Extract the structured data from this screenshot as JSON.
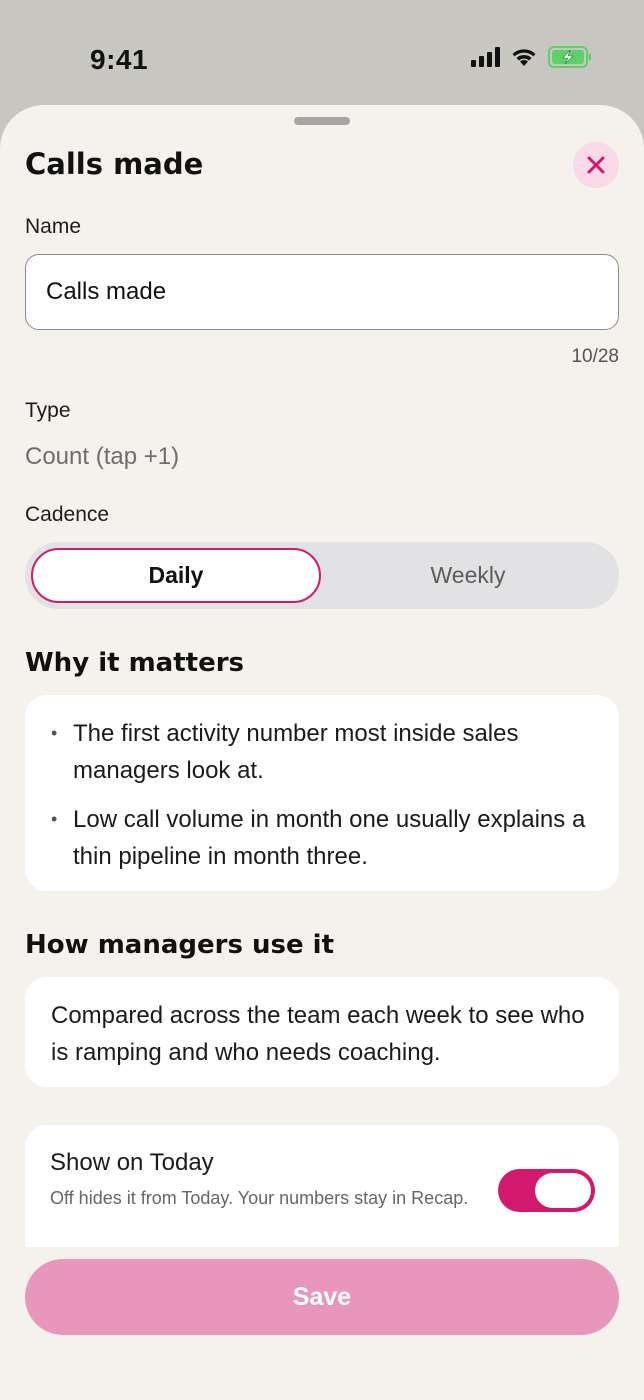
{
  "status_bar": {
    "time": "9:41",
    "icons": [
      "signal-icon",
      "wifi-icon",
      "battery-charging-icon"
    ]
  },
  "sheet": {
    "title": "Calls made",
    "close_icon": "close-icon",
    "name_label": "Name",
    "name_value": "Calls made",
    "name_counter": "10/28",
    "type_label": "Type",
    "type_value": "Count (tap +1)",
    "cadence_label": "Cadence",
    "cadence_options": [
      "Daily",
      "Weekly"
    ],
    "cadence_selected": "Daily",
    "why_title": "Why it matters",
    "why_bullets": [
      "The first activity number most inside sales managers look at.",
      "Low call volume in month one usually explains a thin pipeline in month three."
    ],
    "how_title": "How managers use it",
    "how_text": "Compared across the team each week to see who is ramping and who needs coaching.",
    "show_today_title": "Show on Today",
    "show_today_subtitle": "Off hides it from Today. Your numbers stay in Recap.",
    "show_today_on": true,
    "save_label": "Save"
  },
  "colors": {
    "accent": "#d11a6d",
    "save_button": "#e896bb",
    "close_bg": "#f9d8e7",
    "sheet_bg": "#f5f1ec",
    "battery_green": "#5fd068"
  }
}
